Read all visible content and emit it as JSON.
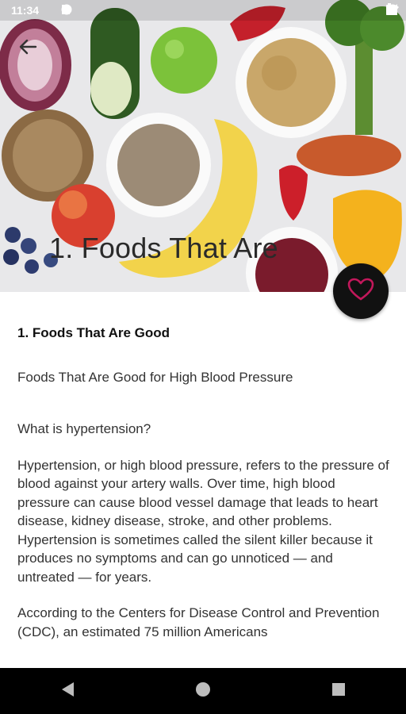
{
  "status_bar": {
    "time": "11:34",
    "left_icons": [
      "gear-icon",
      "sim-card-icon"
    ],
    "right_icons": [
      "wifi-icon",
      "signal-icon",
      "battery-icon"
    ]
  },
  "header": {
    "back_icon": "back-arrow-icon",
    "title": "1. Foods That Are",
    "favorite_icon": "heart-outline-icon",
    "accent_color": "#c2185b"
  },
  "article": {
    "heading": "1. Foods That Are Good",
    "subtitle": "Foods That Are Good for High Blood Pressure",
    "question": "What is hypertension?",
    "paragraph1": "Hypertension, or high blood pressure, refers to the pressure of blood against your artery walls. Over time, high blood pressure can cause blood vessel damage that leads to heart disease, kidney disease, stroke, and other problems. Hypertension is sometimes called the silent killer because it produces no symptoms and can go unnoticed — and untreated — for years.",
    "paragraph2": "According to the Centers for Disease Control and Prevention (CDC), an estimated 75 million Americans"
  },
  "nav_bar": {
    "buttons": [
      "back-triangle-icon",
      "home-circle-icon",
      "recents-square-icon"
    ]
  }
}
